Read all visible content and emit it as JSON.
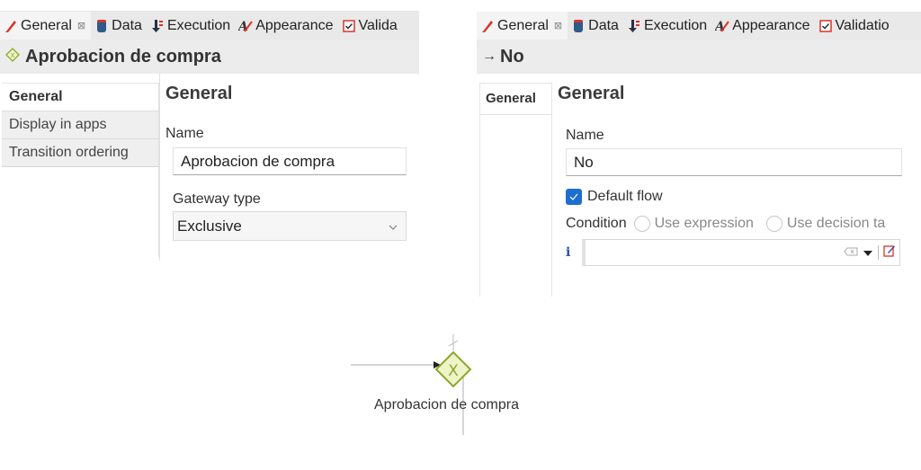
{
  "left_panel": {
    "tabs": [
      {
        "label": "General",
        "icon": "pencil-icon",
        "active": true,
        "closable": true
      },
      {
        "label": "Data",
        "icon": "database-icon"
      },
      {
        "label": "Execution",
        "icon": "execution-icon"
      },
      {
        "label": "Appearance",
        "icon": "appearance-icon"
      },
      {
        "label": "Valida",
        "icon": "validation-checkbox-icon"
      }
    ],
    "title": "Aprobacion de compra",
    "title_icon": "gateway-icon",
    "nav": [
      {
        "label": "General",
        "active": true
      },
      {
        "label": "Display in apps"
      },
      {
        "label": "Transition ordering"
      }
    ],
    "section_title": "General",
    "name_label": "Name",
    "name_value": "Aprobacion de compra",
    "gateway_type_label": "Gateway type",
    "gateway_type_value": "Exclusive"
  },
  "right_panel": {
    "tabs": [
      {
        "label": "General",
        "icon": "pencil-icon",
        "active": true,
        "closable": true
      },
      {
        "label": "Data",
        "icon": "database-icon"
      },
      {
        "label": "Execution",
        "icon": "execution-icon"
      },
      {
        "label": "Appearance",
        "icon": "appearance-icon"
      },
      {
        "label": "Validatio",
        "icon": "validation-checkbox-icon"
      }
    ],
    "title": "No",
    "title_icon": "arrow-right-icon",
    "nav": [
      {
        "label": "General",
        "active": true
      }
    ],
    "section_title": "General",
    "name_label": "Name",
    "name_value": "No",
    "default_flow_label": "Default flow",
    "default_flow_checked": true,
    "condition_label": "Condition",
    "condition_options": [
      "Use expression",
      "Use decision ta"
    ],
    "expression_value": "",
    "info_glyph": "i"
  },
  "diagram": {
    "gateway_label": "Aprobacion de compra",
    "gateway_marker": "X",
    "gateway_color": "#8aa82a",
    "gateway_fill": "#eef3c8"
  }
}
